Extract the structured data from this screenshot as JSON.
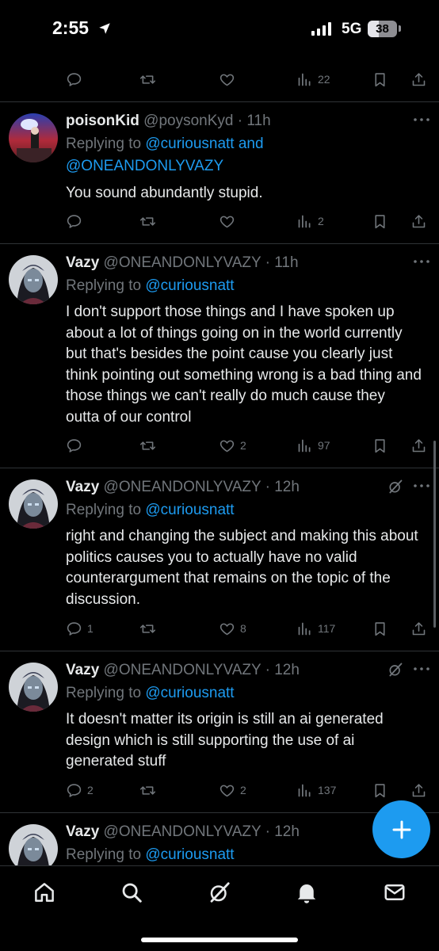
{
  "status_bar": {
    "time": "2:55",
    "network": "5G",
    "battery": "38",
    "battery_level": 0.38
  },
  "tweets": [
    {
      "name": "poisonKid",
      "handle": "@poysonKyd",
      "time": "11h",
      "replying_prefix": "Replying to ",
      "replying_line1": "@curiousnatt and",
      "replying_line2": "@ONEANDONLYVAZY",
      "text": "You sound abundantly stupid.",
      "replies": "",
      "retweets": "",
      "likes": "",
      "views": "2"
    },
    {
      "name": "Vazy",
      "handle": "@ONEANDONLYVAZY",
      "time": "11h",
      "replying_prefix": "Replying to ",
      "replying_to": "@curiousnatt",
      "text": "I don't support those things and I have spoken up about a lot of things going on in the world currently but that's besides the point cause you clearly just think pointing out something wrong is a bad thing and those things we can't really do much cause they outta of our control",
      "replies": "",
      "retweets": "",
      "likes": "2",
      "views": "97"
    },
    {
      "name": "Vazy",
      "handle": "@ONEANDONLYVAZY",
      "time": "12h",
      "replying_prefix": "Replying to ",
      "replying_to": "@curiousnatt",
      "text": "right and changing the subject and making this about politics causes you to actually have no valid counterargument that remains on the topic of the discussion.",
      "replies": "1",
      "retweets": "",
      "likes": "8",
      "views": "117"
    },
    {
      "name": "Vazy",
      "handle": "@ONEANDONLYVAZY",
      "time": "12h",
      "replying_prefix": "Replying to ",
      "replying_to": "@curiousnatt",
      "text": "It doesn't matter its origin is still an ai generated design which is still supporting the use of ai generated stuff",
      "replies": "2",
      "retweets": "",
      "likes": "2",
      "views": "137"
    },
    {
      "name": "Vazy",
      "handle": "@ONEANDONLYVAZY",
      "time": "12h",
      "replying_prefix": "Replying to ",
      "replying_to": "@curiousnatt"
    }
  ],
  "top_actions": {
    "views": "22"
  },
  "separator": " · ",
  "icons": {
    "reply": "reply-icon",
    "retweet": "retweet-icon",
    "like": "heart-icon",
    "views": "views-icon",
    "bookmark": "bookmark-icon",
    "share": "share-icon",
    "more": "more-icon",
    "grok": "grok-icon",
    "compose": "plus-icon",
    "home": "home-icon",
    "search": "search-icon",
    "grok_tab": "grok-icon",
    "notifications": "bell-icon",
    "messages": "mail-icon"
  },
  "colors": {
    "accent": "#1d9bf0",
    "muted": "#71767b",
    "background": "#000000",
    "text": "#e7e9ea"
  }
}
